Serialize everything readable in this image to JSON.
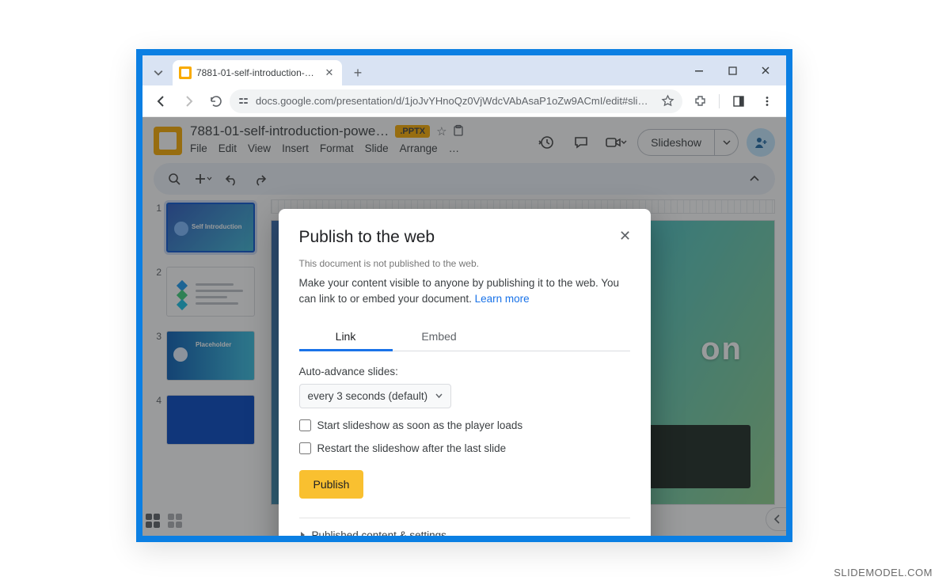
{
  "browser": {
    "tab_title": "7881-01-self-introduction-pow…",
    "url_display": "docs.google.com/presentation/d/1joJvYHnoQz0VjWdcVAbAsaP1oZw9ACmI/edit#sli…"
  },
  "app": {
    "title": "7881-01-self-introduction-powe…",
    "badge": ".PPTX",
    "menus": [
      "File",
      "Edit",
      "View",
      "Insert",
      "Format",
      "Slide",
      "Arrange",
      "…"
    ],
    "slideshow_label": "Slideshow"
  },
  "slides": {
    "thumb1_label": "Self Introduction",
    "thumb3_label": "Placeholder",
    "canvas_text": "on"
  },
  "dialog": {
    "title": "Publish to the web",
    "status": "This document is not published to the web.",
    "description": "Make your content visible to anyone by publishing it to the web. You can link to or embed your document. ",
    "learn_more": "Learn more",
    "tab_link": "Link",
    "tab_embed": "Embed",
    "auto_advance_label": "Auto-advance slides:",
    "auto_advance_value": "every 3 seconds (default)",
    "checkbox1": "Start slideshow as soon as the player loads",
    "checkbox2": "Restart the slideshow after the last slide",
    "publish_btn": "Publish",
    "expand_label": "Published content & settings"
  },
  "watermark": "SLIDEMODEL.COM"
}
